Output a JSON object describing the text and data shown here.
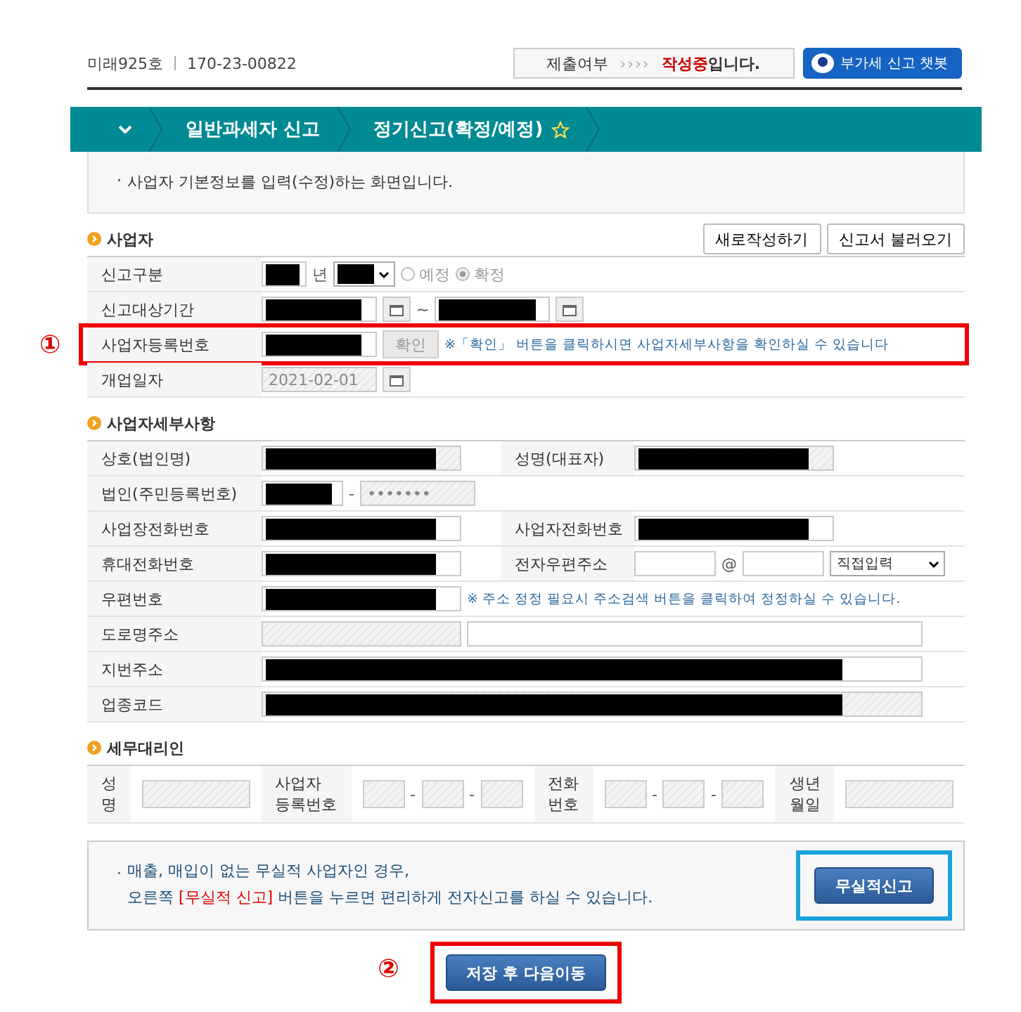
{
  "header": {
    "company": "미래925호",
    "biz_no": "170-23-00822",
    "status_label": "제출여부",
    "status_arrows": "››››",
    "status_value": "작성중",
    "status_suffix": "입니다.",
    "chatbot": "부가세 신고 챗봇"
  },
  "breadcrumb": [
    {
      "label": "일반과세자 신고",
      "favorite": false
    },
    {
      "label": "정기신고(확정/예정)",
      "favorite": true
    }
  ],
  "info": {
    "bullet": "·",
    "text": "사업자 기본정보를 입력(수정)하는 화면입니다."
  },
  "sections": [
    {
      "title": "사업자",
      "buttons": [
        "새로작성하기",
        "신고서 불러오기"
      ],
      "rows": [
        {
          "label": "신고구분",
          "highlight": false,
          "controls": [
            {
              "kind": "field",
              "redacted": true,
              "disabled": false
            },
            {
              "kind": "text",
              "text": "년"
            },
            {
              "kind": "select",
              "redacted": true
            },
            {
              "kind": "radio",
              "text": "예정",
              "selected": false
            },
            {
              "kind": "radio",
              "text": "확정",
              "selected": true
            }
          ]
        },
        {
          "label": "신고대상기간",
          "highlight": false,
          "controls": [
            {
              "kind": "field",
              "redacted": true,
              "disabled": false
            },
            {
              "kind": "date"
            },
            {
              "kind": "text",
              "text": "~"
            },
            {
              "kind": "field",
              "redacted": true,
              "disabled": false
            },
            {
              "kind": "date"
            }
          ]
        },
        {
          "label": "사업자등록번호",
          "highlight": true,
          "callout": "①",
          "controls": [
            {
              "kind": "field",
              "redacted": true,
              "disabled": false
            },
            {
              "kind": "button",
              "text": "확인",
              "disabled": true
            },
            {
              "kind": "note",
              "text": "※「확인」 버튼을 클릭하시면 사업자세부사항을 확인하실 수 있습니다"
            }
          ]
        },
        {
          "label": "개업일자",
          "highlight": false,
          "controls": [
            {
              "kind": "field",
              "redacted": false,
              "disabled": true,
              "value": "2021-02-01"
            },
            {
              "kind": "date"
            }
          ]
        }
      ]
    },
    {
      "title": "사업자세부사항",
      "rows": [
        {
          "label": "상호(법인명)",
          "highlight": false,
          "controls": [
            {
              "kind": "field",
              "redacted": true,
              "disabled": true
            }
          ],
          "label2": "성명(대표자)",
          "controls2": [
            {
              "kind": "field",
              "redacted": true,
              "disabled": true
            }
          ]
        },
        {
          "label": "법인(주민등록번호)",
          "highlight": false,
          "controls": [
            {
              "kind": "field",
              "redacted": true,
              "disabled": false
            },
            {
              "kind": "text",
              "text": "-"
            },
            {
              "kind": "field",
              "redacted": false,
              "disabled": true,
              "value": "•••••••"
            }
          ]
        },
        {
          "label": "사업장전화번호",
          "highlight": false,
          "controls": [
            {
              "kind": "field",
              "redacted": true,
              "disabled": false
            }
          ],
          "label2": "사업자전화번호",
          "controls2": [
            {
              "kind": "field",
              "redacted": true,
              "disabled": false
            }
          ]
        },
        {
          "label": "휴대전화번호",
          "highlight": false,
          "controls": [
            {
              "kind": "field",
              "redacted": true,
              "disabled": false
            }
          ],
          "label2": "전자우편주소",
          "controls2": [
            {
              "kind": "field",
              "redacted": false,
              "disabled": false
            },
            {
              "kind": "text",
              "text": "@"
            },
            {
              "kind": "field",
              "redacted": false,
              "disabled": false
            },
            {
              "kind": "select",
              "redacted": false,
              "text": "직접입력"
            }
          ]
        },
        {
          "label": "우편번호",
          "highlight": false,
          "controls": [
            {
              "kind": "field",
              "redacted": true,
              "disabled": false
            },
            {
              "kind": "note",
              "text": "※ 주소 정정 필요시 주소검색 버튼을 클릭하여 정정하실 수 있습니다."
            }
          ]
        },
        {
          "label": "도로명주소",
          "highlight": false,
          "controls": [
            {
              "kind": "field",
              "redacted": false,
              "disabled": true
            },
            {
              "kind": "field",
              "redacted": false,
              "disabled": false
            }
          ]
        },
        {
          "label": "지번주소",
          "highlight": false,
          "controls": [
            {
              "kind": "field",
              "redacted": true,
              "disabled": false
            }
          ]
        },
        {
          "label": "업종코드",
          "highlight": false,
          "controls": [
            {
              "kind": "field",
              "redacted": true,
              "disabled": true
            }
          ]
        }
      ]
    }
  ],
  "agent": {
    "title": "세무대리인",
    "items": [
      {
        "label_lines": [
          "성",
          "명"
        ],
        "parts": [
          {
            "kind": "field"
          }
        ]
      },
      {
        "label_lines": [
          "사업자",
          "등록번호"
        ],
        "parts": [
          {
            "kind": "field"
          },
          {
            "kind": "text",
            "text": "-"
          },
          {
            "kind": "field"
          },
          {
            "kind": "text",
            "text": "-"
          },
          {
            "kind": "field"
          }
        ]
      },
      {
        "label_lines": [
          "전화",
          "번호"
        ],
        "parts": [
          {
            "kind": "field"
          },
          {
            "kind": "text",
            "text": "-"
          },
          {
            "kind": "field"
          },
          {
            "kind": "text",
            "text": "-"
          },
          {
            "kind": "field"
          }
        ]
      },
      {
        "label_lines": [
          "생년",
          "월일"
        ],
        "parts": [
          {
            "kind": "field"
          }
        ]
      }
    ]
  },
  "notice": {
    "bullet": "·",
    "lines": [
      "매출, 매입이 없는 무실적 사업자인 경우,",
      "오른쪽 **[무실적 신고]** 버튼을 누르면 편리하게 전자신고를 하실 수 있습니다."
    ],
    "button": "무실적신고",
    "highlight": true
  },
  "save": {
    "label": "저장 후 다음이동",
    "callout": "②",
    "highlight": true
  }
}
